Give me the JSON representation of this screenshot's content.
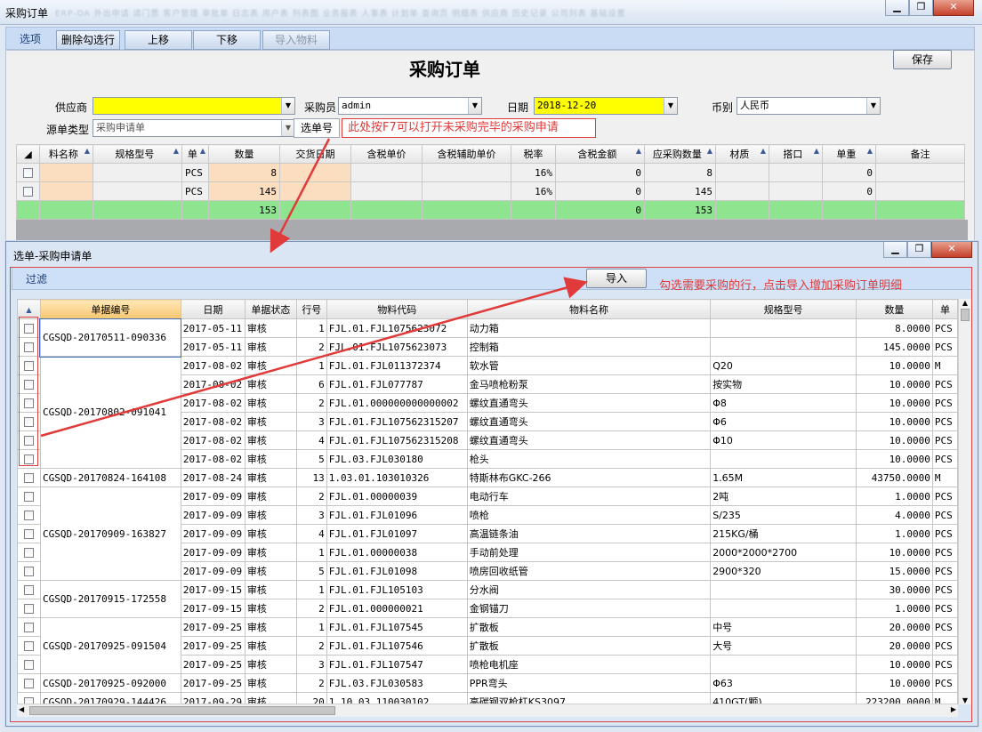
{
  "window": {
    "title": "采购订单",
    "blurred_tabs": "ERP-OA  外出申请  请门票  客户管理  审批单  日志表  用户表  列表图  业务报表  人事表  计划单 查询页 明细表  供应商  历史记录  公司列表  基础设置"
  },
  "toolbar": {
    "options": "选项",
    "delete_checked": "删除勾选行",
    "move_up": "上移",
    "move_down": "下移",
    "import_material": "导入物料"
  },
  "form": {
    "title": "采购订单",
    "save": "保存",
    "supplier_label": "供应商",
    "supplier_value": "",
    "buyer_label": "采购员",
    "buyer_value": "admin",
    "date_label": "日期",
    "date_value": "2018-12-20",
    "currency_label": "币别",
    "currency_value": "人民币",
    "source_label": "源单类型",
    "source_value": "采购申请单",
    "select_btn": "选单号",
    "annotation": "此处按F7可以打开未采购完毕的采购申请"
  },
  "upper_grid": {
    "columns": [
      "料名称",
      "规格型号",
      "单",
      "数量",
      "交货日期",
      "含税单价",
      "含税辅助单价",
      "税率",
      "含税金额",
      "应采购数量",
      "材质",
      "搭口",
      "单重",
      "备注"
    ],
    "rows": [
      [
        "",
        "",
        "PCS",
        "8",
        "",
        "",
        "",
        "16%",
        "0",
        "8",
        "",
        "",
        "0",
        ""
      ],
      [
        "",
        "",
        "PCS",
        "145",
        "",
        "",
        "",
        "16%",
        "0",
        "145",
        "",
        "",
        "0",
        ""
      ]
    ],
    "total": [
      "",
      "",
      "",
      "153",
      "",
      "",
      "",
      "",
      "0",
      "153",
      "",
      "",
      "",
      ""
    ]
  },
  "dialog": {
    "title": "选单-采购申请单",
    "filter": "过滤",
    "import": "导入",
    "annotation": "勾选需要采购的行，点击导入增加采购订单明细",
    "columns": [
      "单据编号",
      "日期",
      "单据状态",
      "行号",
      "物料代码",
      "物料名称",
      "规格型号",
      "数量",
      "单"
    ],
    "rows": [
      [
        "CGSQD-20170511-090336",
        "2017-05-11",
        "审核",
        "1",
        "FJL.01.FJL1075623072",
        "动力箱",
        "",
        "8.0000",
        "PCS"
      ],
      [
        "",
        "2017-05-11",
        "审核",
        "2",
        "FJL.01.FJL1075623073",
        "控制箱",
        "",
        "145.0000",
        "PCS"
      ],
      [
        "CGSQD-20170802-091041",
        "2017-08-02",
        "审核",
        "1",
        "FJL.01.FJL011372374",
        "软水管",
        "Q20",
        "10.0000",
        "M"
      ],
      [
        "",
        "2017-08-02",
        "审核",
        "6",
        "FJL.01.FJL077787",
        "金马喷枪粉泵",
        "按实物",
        "10.0000",
        "PCS"
      ],
      [
        "",
        "2017-08-02",
        "审核",
        "2",
        "FJL.01.000000000000002",
        "螺纹直通弯头",
        "Φ8",
        "10.0000",
        "PCS"
      ],
      [
        "",
        "2017-08-02",
        "审核",
        "3",
        "FJL.01.FJL107562315207",
        "螺纹直通弯头",
        "Φ6",
        "10.0000",
        "PCS"
      ],
      [
        "",
        "2017-08-02",
        "审核",
        "4",
        "FJL.01.FJL107562315208",
        "螺纹直通弯头",
        "Φ10",
        "10.0000",
        "PCS"
      ],
      [
        "",
        "2017-08-02",
        "审核",
        "5",
        "FJL.03.FJL030180",
        "枪头",
        "",
        "10.0000",
        "PCS"
      ],
      [
        "CGSQD-20170824-164108",
        "2017-08-24",
        "审核",
        "13",
        "1.03.01.103010326",
        "特斯林布GKC-266",
        "1.65M",
        "43750.0000",
        "M"
      ],
      [
        "CGSQD-20170909-163827",
        "2017-09-09",
        "审核",
        "2",
        "FJL.01.00000039",
        "电动行车",
        "2吨",
        "1.0000",
        "PCS"
      ],
      [
        "",
        "2017-09-09",
        "审核",
        "3",
        "FJL.01.FJL01096",
        "喷枪",
        "S/235",
        "4.0000",
        "PCS"
      ],
      [
        "",
        "2017-09-09",
        "审核",
        "4",
        "FJL.01.FJL01097",
        "高温链条油",
        "215KG/桶",
        "1.0000",
        "PCS"
      ],
      [
        "",
        "2017-09-09",
        "审核",
        "1",
        "FJL.01.00000038",
        "手动前处理",
        "2000*2000*2700",
        "10.0000",
        "PCS"
      ],
      [
        "",
        "2017-09-09",
        "审核",
        "5",
        "FJL.01.FJL01098",
        "喷房回收纸管",
        "2900*320",
        "15.0000",
        "PCS"
      ],
      [
        "CGSQD-20170915-172558",
        "2017-09-15",
        "审核",
        "1",
        "FJL.01.FJL105103",
        "分水阀",
        "",
        "30.0000",
        "PCS"
      ],
      [
        "",
        "2017-09-15",
        "审核",
        "2",
        "FJL.01.000000021",
        "金钢锚刀",
        "",
        "1.0000",
        "PCS"
      ],
      [
        "CGSQD-20170925-091504",
        "2017-09-25",
        "审核",
        "1",
        "FJL.01.FJL107545",
        "扩散板",
        "中号",
        "20.0000",
        "PCS"
      ],
      [
        "",
        "2017-09-25",
        "审核",
        "2",
        "FJL.01.FJL107546",
        "扩散板",
        "大号",
        "20.0000",
        "PCS"
      ],
      [
        "",
        "2017-09-25",
        "审核",
        "3",
        "FJL.01.FJL107547",
        "喷枪电机座",
        "",
        "10.0000",
        "PCS"
      ],
      [
        "CGSQD-20170925-092000",
        "2017-09-25",
        "审核",
        "2",
        "FJL.03.FJL030583",
        "PPR弯头",
        "Φ63",
        "10.0000",
        "PCS"
      ],
      [
        "CGSQD-20170929-144426",
        "2017-09-29",
        "审核",
        "20",
        "1.10.03.110030102",
        "高碳钢双枪杠KS3097",
        "410GT(颗)",
        "223200.0000",
        "M"
      ]
    ]
  },
  "colors": {
    "accent_red": "#e03a3a",
    "yellow_field": "#ffff00",
    "peach": "#fbddc0",
    "green_total": "#8fe58f"
  }
}
